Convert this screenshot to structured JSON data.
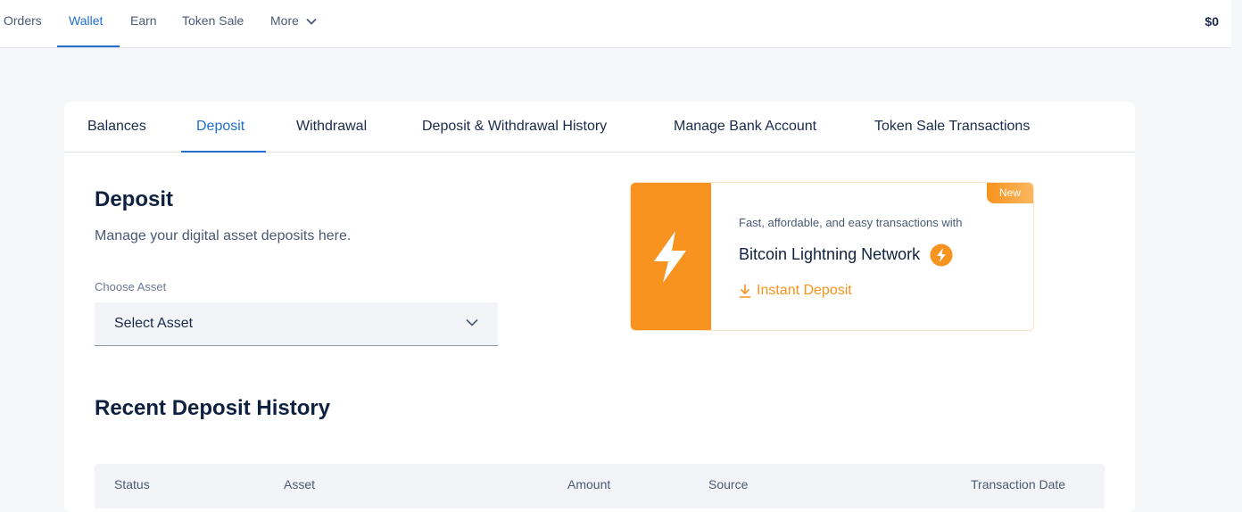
{
  "topnav": {
    "items": [
      "Orders",
      "Wallet",
      "Earn",
      "Token Sale",
      "More"
    ],
    "active": "Wallet",
    "balance": "$0"
  },
  "tabs": [
    "Balances",
    "Deposit",
    "Withdrawal",
    "Deposit & Withdrawal History",
    "Manage Bank Account",
    "Token Sale Transactions"
  ],
  "active_tab": "Deposit",
  "deposit": {
    "title": "Deposit",
    "subtitle": "Manage your digital asset deposits here.",
    "choose_label": "Choose Asset",
    "select_value": "Select Asset"
  },
  "promo": {
    "badge": "New",
    "tagline": "Fast, affordable, and easy transactions with",
    "network": "Bitcoin Lightning Network",
    "cta": "Instant Deposit",
    "accent": "#f7931e"
  },
  "history": {
    "title": "Recent Deposit History",
    "columns": [
      "Status",
      "Asset",
      "Amount",
      "Source",
      "Transaction Date"
    ]
  },
  "colors": {
    "primary": "#1f6fd1",
    "text": "#1a2b4c",
    "background": "#f5f6f8"
  },
  "icons": [
    "chevron-down-icon",
    "lightning-bolt-icon",
    "download-icon"
  ]
}
